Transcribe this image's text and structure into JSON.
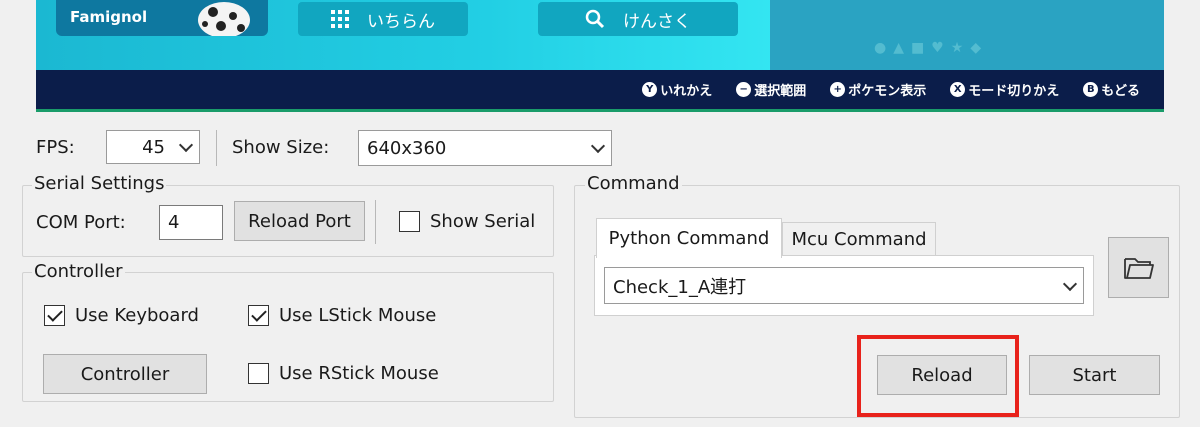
{
  "preview": {
    "game_title": "Famignol",
    "list_button": "いちらん",
    "search_button": "けんさく",
    "shape_icons": [
      "●",
      "▲",
      "■",
      "♥",
      "★",
      "◆"
    ],
    "hints": [
      {
        "glyph": "Y",
        "label": "いれかえ"
      },
      {
        "glyph": "−",
        "label": "選択範囲"
      },
      {
        "glyph": "+",
        "label": "ポケモン表示"
      },
      {
        "glyph": "X",
        "label": "モード切りかえ"
      },
      {
        "glyph": "B",
        "label": "もどる"
      }
    ],
    "colors": {
      "screen": "#22cfe4",
      "bar": "#0b1d4a",
      "accent": "#0e78a0"
    }
  },
  "toolbar": {
    "fps_label": "FPS:",
    "fps_value": "45",
    "show_size_label": "Show Size:",
    "show_size_value": "640x360"
  },
  "serial": {
    "title": "Serial Settings",
    "com_port_label": "COM Port:",
    "com_port_value": "4",
    "reload_port_label": "Reload Port",
    "show_serial_label": "Show Serial",
    "show_serial_checked": false
  },
  "controller": {
    "title": "Controller",
    "use_keyboard_label": "Use Keyboard",
    "use_keyboard_checked": true,
    "use_lstick_label": "Use LStick Mouse",
    "use_lstick_checked": true,
    "use_rstick_label": "Use RStick Mouse",
    "use_rstick_checked": false,
    "controller_button_label": "Controller"
  },
  "command": {
    "title": "Command",
    "tabs": [
      {
        "label": "Python Command",
        "active": true
      },
      {
        "label": "Mcu Command",
        "active": false
      }
    ],
    "selected_command": "Check_1_A連打",
    "reload_label": "Reload",
    "start_label": "Start",
    "highlight_color": "#e8221b"
  }
}
